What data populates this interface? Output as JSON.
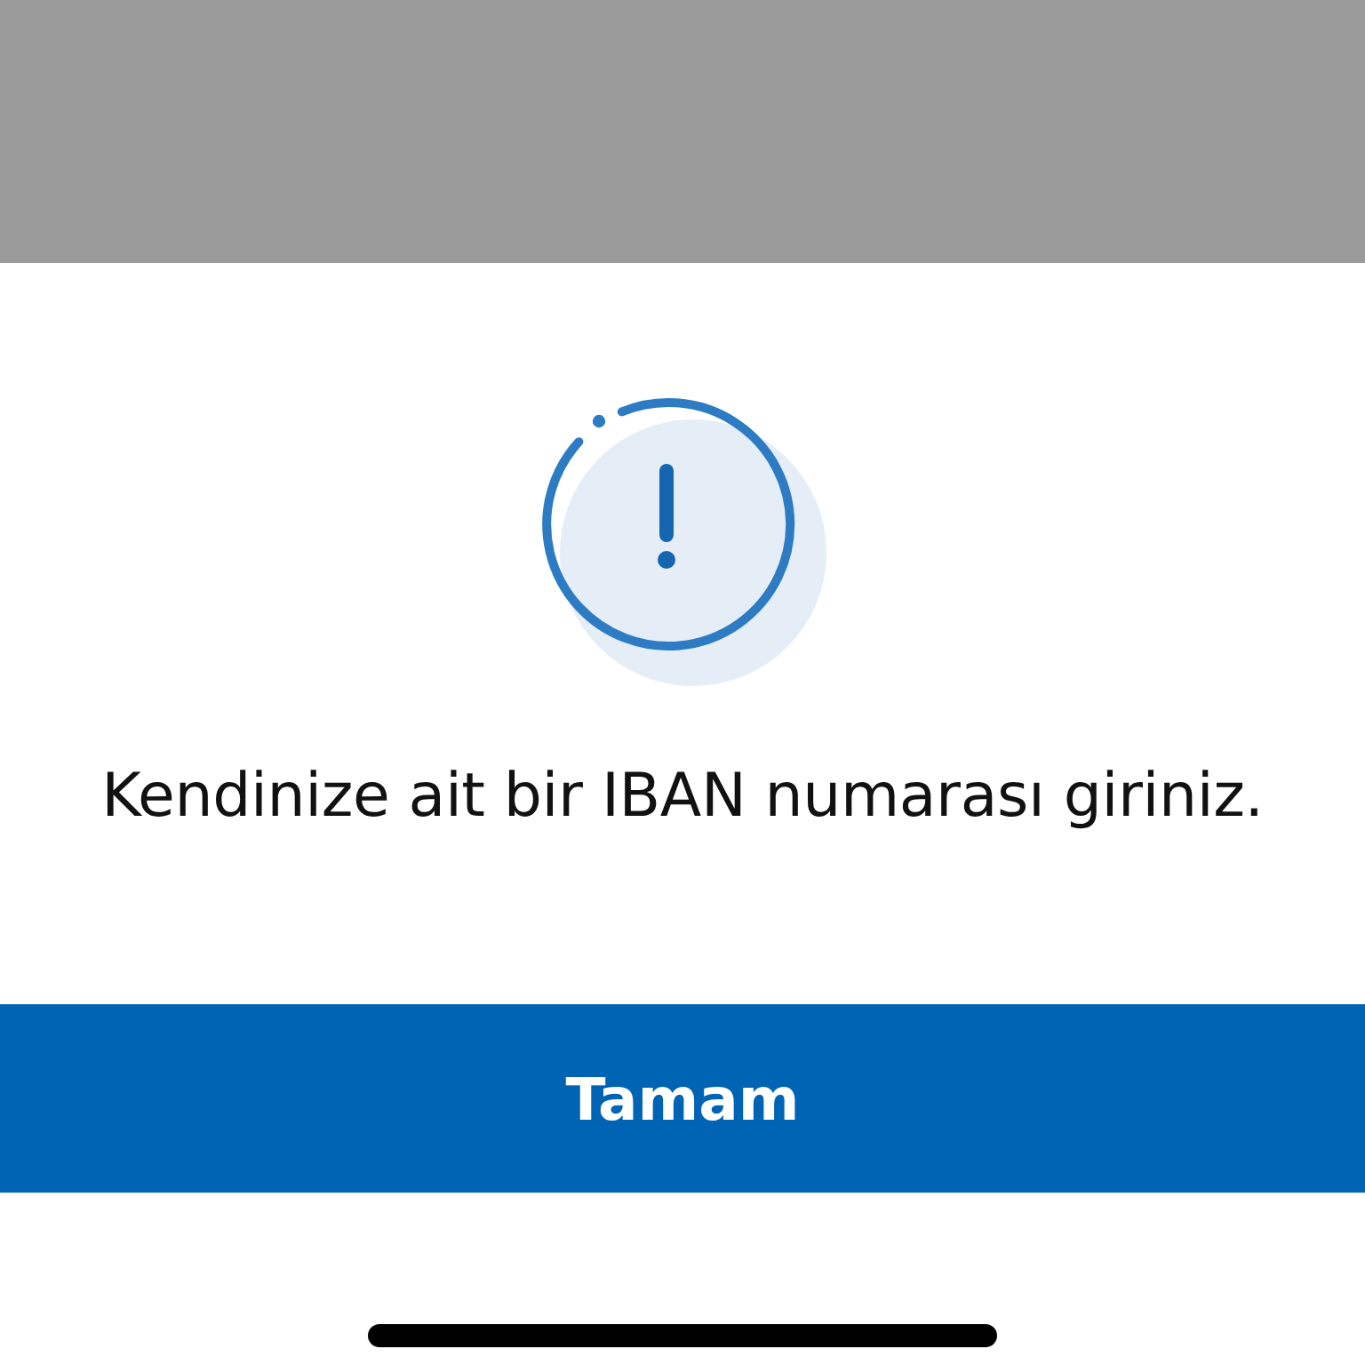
{
  "dialog": {
    "message": "Kendinize ait bir IBAN numarası giriniz.",
    "confirm_button": "Tamam"
  }
}
